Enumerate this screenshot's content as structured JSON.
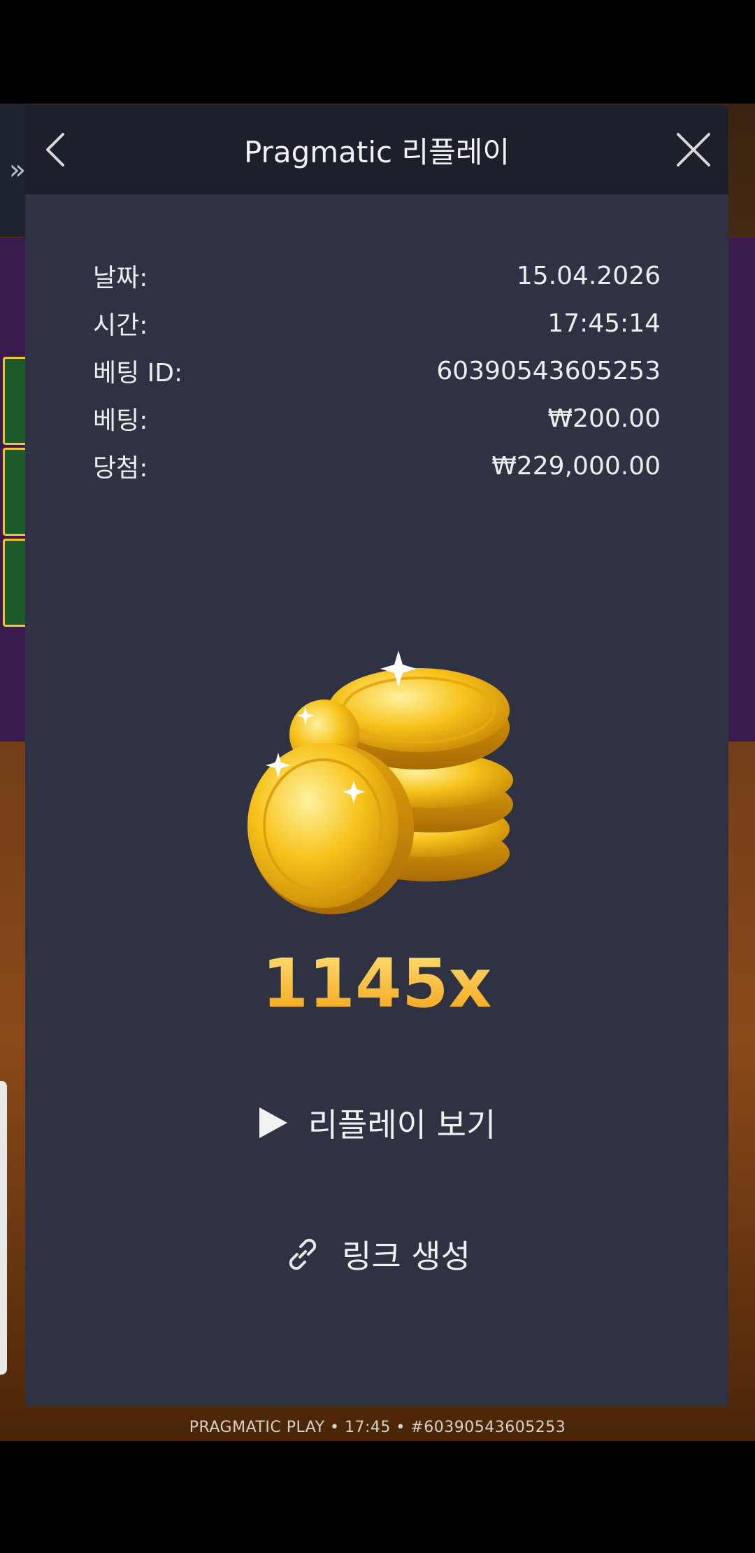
{
  "modal": {
    "title": "Pragmatic 리플레이",
    "back_icon": "chevron-left-icon",
    "close_icon": "close-icon"
  },
  "side_tab": {
    "icon": "double-chevron-right-icon",
    "glyph": "»"
  },
  "details": [
    {
      "label": "날짜:",
      "value": "15.04.2026"
    },
    {
      "label": "시간:",
      "value": "17:45:14"
    },
    {
      "label": "베팅 ID:",
      "value": "60390543605253"
    },
    {
      "label": "베팅:",
      "value": "₩200.00"
    },
    {
      "label": "당첨:",
      "value": "₩229,000.00"
    }
  ],
  "win": {
    "multiplier": "1145x",
    "icon": "gold-coins-icon"
  },
  "actions": {
    "replay_label": "리플레이 보기",
    "replay_icon": "play-icon",
    "link_label": "링크 생성",
    "link_icon": "link-icon"
  },
  "footer": {
    "text": "PRAGMATIC PLAY • 17:45 • #60390543605253"
  },
  "colors": {
    "modal_bg": "#2f3242",
    "header_bg": "#1d202b",
    "multiplier": "#f5b41c"
  }
}
